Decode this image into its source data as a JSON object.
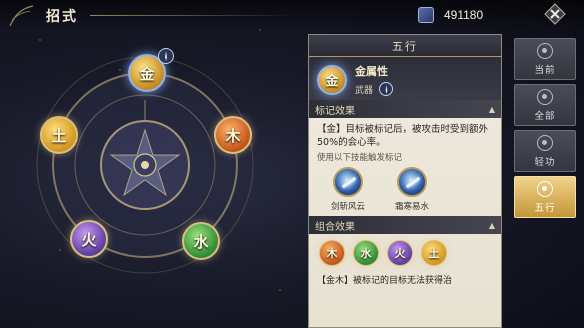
{
  "header": {
    "title": "招式",
    "currency_value": "491180",
    "currency_icon": "book-icon",
    "close_icon": "close-icon"
  },
  "wheel": {
    "elements": [
      {
        "key": "gold",
        "label": "金",
        "selected": true
      },
      {
        "key": "wood",
        "label": "木"
      },
      {
        "key": "water",
        "label": "水"
      },
      {
        "key": "fire",
        "label": "火"
      },
      {
        "key": "earth",
        "label": "土"
      }
    ]
  },
  "panel": {
    "title": "五行",
    "attribute_icon_label": "金",
    "attribute_name": "金属性",
    "attribute_type": "武器",
    "mark_section_title": "标记效果",
    "mark_desc": "【金】目标被标记后，被攻击时受到额外50%的会心率。",
    "mark_note": "使用以下技能触发标记",
    "skills": [
      {
        "label": "剑斩风云"
      },
      {
        "label": "霜寒易水"
      }
    ],
    "combo_section_title": "组合效果",
    "combo_elements": [
      "木",
      "水",
      "火",
      "土"
    ],
    "combo_desc": "【金木】被标记的目标无法获得治"
  },
  "tabs": [
    {
      "label": "当前",
      "active": false
    },
    {
      "label": "全部",
      "active": false
    },
    {
      "label": "轻功",
      "active": false
    },
    {
      "label": "五行",
      "active": true
    }
  ]
}
